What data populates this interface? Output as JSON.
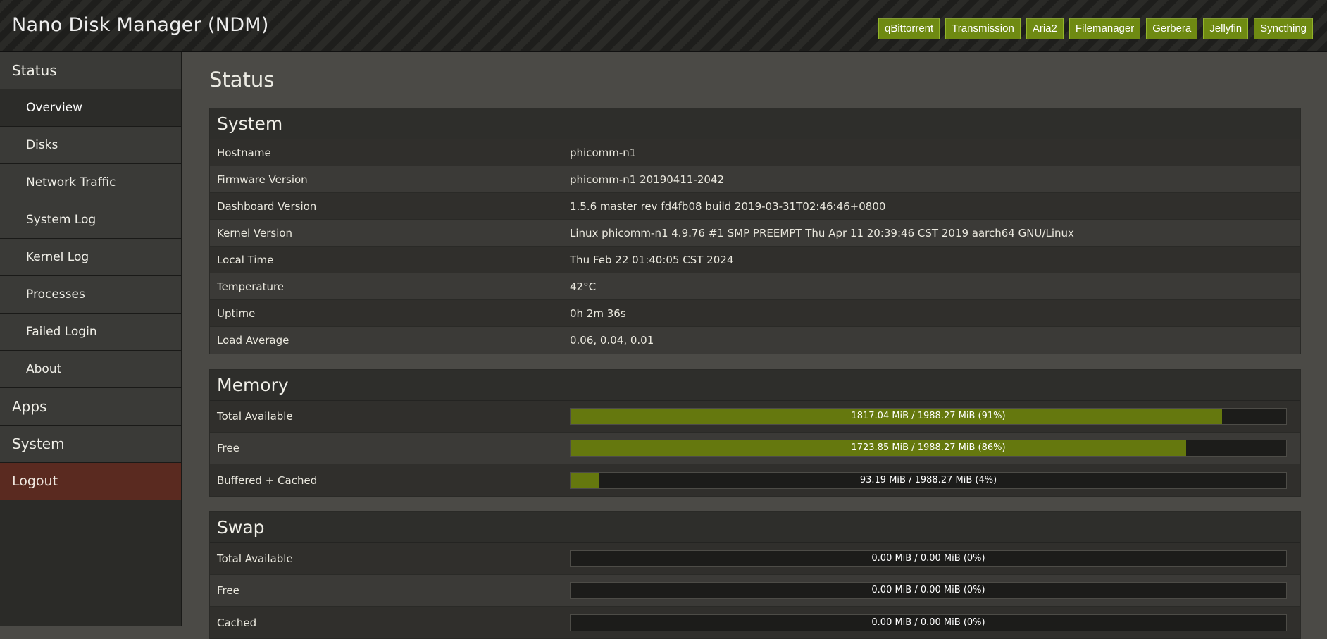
{
  "header": {
    "title": "Nano Disk Manager (NDM)",
    "apps": [
      "qBittorrent",
      "Transmission",
      "Aria2",
      "Filemanager",
      "Gerbera",
      "Jellyfin",
      "Syncthing"
    ]
  },
  "sidebar": {
    "status": "Status",
    "items": [
      "Overview",
      "Disks",
      "Network Traffic",
      "System Log",
      "Kernel Log",
      "Processes",
      "Failed Login",
      "About"
    ],
    "apps": "Apps",
    "system": "System",
    "logout": "Logout"
  },
  "page": {
    "title": "Status"
  },
  "system": {
    "title": "System",
    "rows": [
      {
        "label": "Hostname",
        "value": "phicomm-n1"
      },
      {
        "label": "Firmware Version",
        "value": "phicomm-n1 20190411-2042"
      },
      {
        "label": "Dashboard Version",
        "value": "1.5.6 master rev fd4fb08 build 2019-03-31T02:46:46+0800"
      },
      {
        "label": "Kernel Version",
        "value": "Linux phicomm-n1 4.9.76 #1 SMP PREEMPT Thu Apr 11 20:39:46 CST 2019 aarch64 GNU/Linux"
      },
      {
        "label": "Local Time",
        "value": "Thu Feb 22 01:40:05 CST 2024"
      },
      {
        "label": "Temperature",
        "value": "42°C"
      },
      {
        "label": "Uptime",
        "value": "0h 2m 36s"
      },
      {
        "label": "Load Average",
        "value": "0.06, 0.04, 0.01"
      }
    ]
  },
  "memory": {
    "title": "Memory",
    "rows": [
      {
        "label": "Total Available",
        "text": "1817.04 MiB / 1988.27 MiB (91%)",
        "percent": 91
      },
      {
        "label": "Free",
        "text": "1723.85 MiB / 1988.27 MiB (86%)",
        "percent": 86
      },
      {
        "label": "Buffered + Cached",
        "text": "93.19 MiB / 1988.27 MiB (4%)",
        "percent": 4
      }
    ]
  },
  "swap": {
    "title": "Swap",
    "rows": [
      {
        "label": "Total Available",
        "text": "0.00 MiB / 0.00 MiB (0%)",
        "percent": 0
      },
      {
        "label": "Free",
        "text": "0.00 MiB / 0.00 MiB (0%)",
        "percent": 0
      },
      {
        "label": "Cached",
        "text": "0.00 MiB / 0.00 MiB (0%)",
        "percent": 0
      }
    ]
  }
}
